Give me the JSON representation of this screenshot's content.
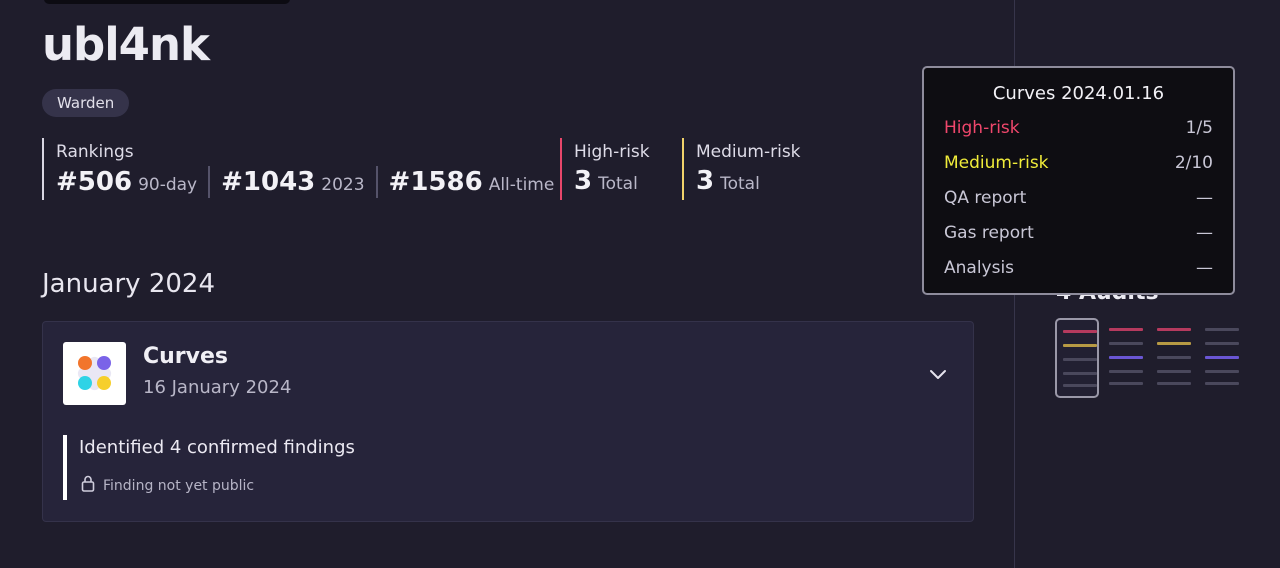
{
  "profile": {
    "username": "ubl4nk",
    "role": "Warden"
  },
  "stats": {
    "rankings_label": "Rankings",
    "ranks": [
      {
        "value": "#506",
        "period": "90-day"
      },
      {
        "value": "#1043",
        "period": "2023"
      },
      {
        "value": "#1586",
        "period": "All-time"
      }
    ],
    "high_risk": {
      "label": "High-risk",
      "value": "3",
      "unit": "Total",
      "color": "#e8466a"
    },
    "medium_risk": {
      "label": "Medium-risk",
      "value": "3",
      "unit": "Total",
      "color": "#f0d26a"
    }
  },
  "timeline": {
    "month": "January 2024",
    "audit": {
      "name": "Curves",
      "date": "16 January 2024",
      "findings": "Identified 4 confirmed findings",
      "privacy_note": "Finding not yet public"
    }
  },
  "sidebar": {
    "audits_count": "4 Audits"
  },
  "tooltip": {
    "title": "Curves 2024.01.16",
    "rows": [
      {
        "label": "High-risk",
        "value": "1/5"
      },
      {
        "label": "Medium-risk",
        "value": "2/10"
      },
      {
        "label": "QA report",
        "value": "—"
      },
      {
        "label": "Gas report",
        "value": "—"
      },
      {
        "label": "Analysis",
        "value": "—"
      }
    ]
  },
  "colors": {
    "background": "#1f1d2c",
    "card": "#26243a",
    "high": "#f0476c",
    "medium": "#f0ec3a",
    "accent_purple": "#7a63e8"
  }
}
